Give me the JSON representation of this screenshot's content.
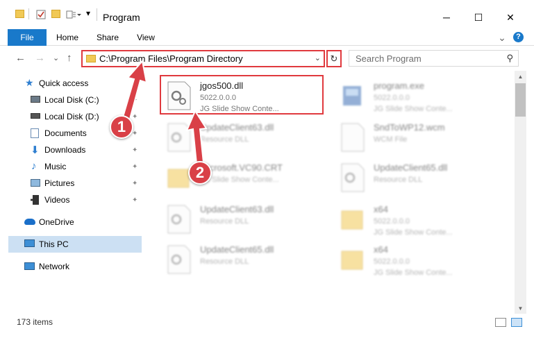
{
  "window": {
    "title": "Program",
    "minimize_glyph": "─",
    "maximize_glyph": "☐",
    "close_glyph": "✕"
  },
  "ribbon": {
    "tabs": [
      "File",
      "Home",
      "Share",
      "View"
    ],
    "collapse_glyph": "⌄",
    "help_glyph": "?"
  },
  "nav": {
    "back_glyph": "←",
    "forward_glyph": "→",
    "recent_glyph": "⌄",
    "up_glyph": "↑"
  },
  "address": {
    "path": "C:\\Program Files\\Program Directory",
    "dropdown_glyph": "⌄",
    "refresh_glyph": "↻"
  },
  "search": {
    "placeholder": "Search Program",
    "icon_glyph": "⚲"
  },
  "sidebar": {
    "items": [
      {
        "label": "Quick access",
        "icon": "star-icon",
        "pinned": false
      },
      {
        "label": "Local Disk (C:)",
        "icon": "drive-icon",
        "pinned": true
      },
      {
        "label": "Local Disk (D:)",
        "icon": "drive-icon",
        "pinned": true
      },
      {
        "label": "Documents",
        "icon": "documents-icon",
        "pinned": true
      },
      {
        "label": "Downloads",
        "icon": "download-icon",
        "pinned": true
      },
      {
        "label": "Music",
        "icon": "music-icon",
        "pinned": true
      },
      {
        "label": "Pictures",
        "icon": "pictures-icon",
        "pinned": true
      },
      {
        "label": "Videos",
        "icon": "videos-icon",
        "pinned": true
      },
      {
        "label": "OneDrive",
        "icon": "cloud-icon",
        "pinned": false
      },
      {
        "label": "This PC",
        "icon": "computer-icon",
        "pinned": false
      },
      {
        "label": "Network",
        "icon": "network-icon",
        "pinned": false
      }
    ],
    "pin_glyph": "✦"
  },
  "files": [
    {
      "name": "jgos500.dll",
      "line2": "5022.0.0.0",
      "line3": "JG Slide Show Conte...",
      "type": "dll"
    },
    {
      "name": "program.exe",
      "line2": "5022.0.0.0",
      "line3": "JG Slide Show Conte...",
      "type": "exe"
    },
    {
      "name": "UpdateClient63.dll",
      "line2": "Resource DLL",
      "line3": "",
      "type": "dll"
    },
    {
      "name": "SndToWP12.wcm",
      "line2": "WCM File",
      "line3": "",
      "type": "file"
    },
    {
      "name": "Microsoft.VC90.CRT",
      "line2": "JG Slide Show Conte...",
      "line3": "",
      "type": "folder"
    },
    {
      "name": "UpdateClient65.dll",
      "line2": "Resource DLL",
      "line3": "",
      "type": "dll"
    },
    {
      "name": "UpdateClient63.dll",
      "line2": "Resource DLL",
      "line3": "",
      "type": "dll"
    },
    {
      "name": "x64",
      "line2": "5022.0.0.0",
      "line3": "JG Slide Show Conte...",
      "type": "folder"
    },
    {
      "name": "UpdateClient65.dll",
      "line2": "Resource DLL",
      "line3": "",
      "type": "dll"
    },
    {
      "name": "x64",
      "line2": "5022.0.0.0",
      "line3": "JG Slide Show Conte...",
      "type": "folder"
    }
  ],
  "status": {
    "item_count": "173 items"
  },
  "callouts": [
    "1",
    "2"
  ],
  "colors": {
    "accent": "#1979ca",
    "highlight": "#e0393e",
    "badge": "#d94047",
    "selected": "#cce0f3"
  }
}
